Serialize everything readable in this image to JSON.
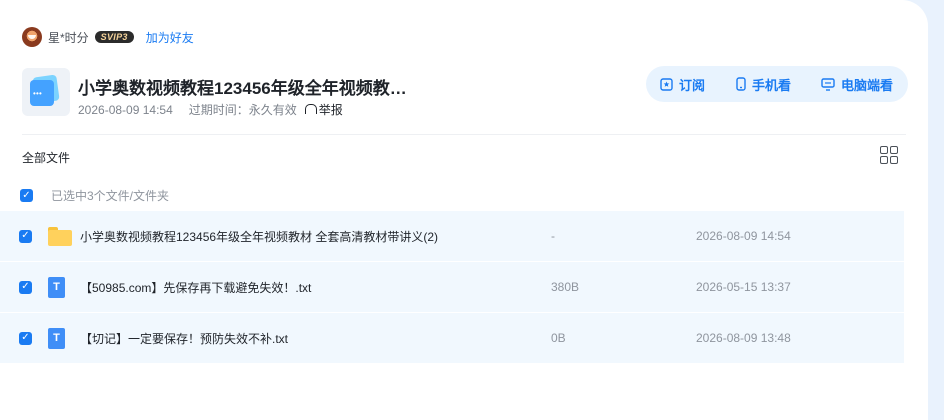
{
  "sharer": {
    "name": "星*时分",
    "vip": "SVIP3",
    "add_friend": "加为好友"
  },
  "share": {
    "title": "小学奥数视频教程123456年级全年视频教…",
    "created": "2026-08-09 14:54",
    "expire_label": "过期时间：",
    "expire_value": "永久有效",
    "report": "举报"
  },
  "actions": {
    "subscribe": "订阅",
    "mobile": "手机看",
    "pc": "电脑端看"
  },
  "list": {
    "header": "全部文件",
    "selection_text": "已选中3个文件/文件夹",
    "files": [
      {
        "type": "folder",
        "name": "小学奥数视频教程123456年级全年视频教材 全套高清教材带讲义(2)",
        "size": "-",
        "date": "2026-08-09 14:54"
      },
      {
        "type": "txt",
        "icon_letter": "T",
        "name": "【50985.com】先保存再下载避免失效！.txt",
        "size": "380B",
        "date": "2026-05-15 13:37"
      },
      {
        "type": "txt",
        "icon_letter": "T",
        "name": "【切记】一定要保存！预防失效不补.txt",
        "size": "0B",
        "date": "2026-08-09 13:48"
      }
    ]
  },
  "colors": {
    "accent": "#1a7bf2",
    "row_bg": "#f1f8fe",
    "page_bg": "#e9f2fd"
  }
}
